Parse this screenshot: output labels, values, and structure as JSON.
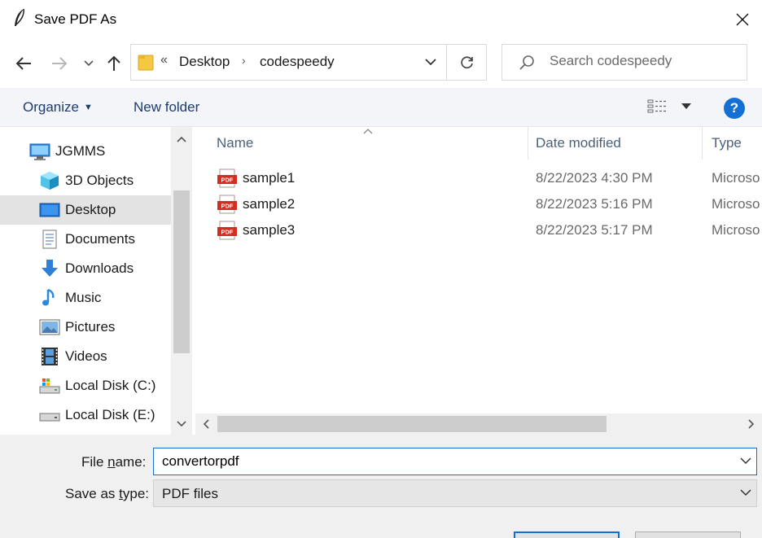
{
  "window": {
    "title": "Save PDF As"
  },
  "nav": {
    "back_icon": "arrow-left-icon",
    "forward_icon": "arrow-right-icon",
    "recent_icon": "chevron-down-icon",
    "up_icon": "arrow-up-icon"
  },
  "address": {
    "overflow": "«",
    "segments": [
      "Desktop",
      "codespeedy"
    ]
  },
  "search": {
    "placeholder": "Search codespeedy"
  },
  "toolbar": {
    "organize": "Organize",
    "new_folder": "New folder",
    "help": "?"
  },
  "tree": {
    "items": [
      {
        "label": "JGMMS",
        "icon": "computer-icon"
      },
      {
        "label": "3D Objects",
        "icon": "cube-icon"
      },
      {
        "label": "Desktop",
        "icon": "desktop-icon",
        "selected": true
      },
      {
        "label": "Documents",
        "icon": "document-icon"
      },
      {
        "label": "Downloads",
        "icon": "download-icon"
      },
      {
        "label": "Music",
        "icon": "music-note-icon"
      },
      {
        "label": "Pictures",
        "icon": "picture-icon"
      },
      {
        "label": "Videos",
        "icon": "film-icon"
      },
      {
        "label": "Local Disk (C:)",
        "icon": "drive-icon"
      },
      {
        "label": "Local Disk (E:)",
        "icon": "drive-icon"
      }
    ]
  },
  "files": {
    "columns": [
      "Name",
      "Date modified",
      "Type"
    ],
    "rows": [
      {
        "name": "sample1",
        "date": "8/22/2023 4:30 PM",
        "type": "Microso"
      },
      {
        "name": "sample2",
        "date": "8/22/2023 5:16 PM",
        "type": "Microso"
      },
      {
        "name": "sample3",
        "date": "8/22/2023 5:17 PM",
        "type": "Microso"
      }
    ]
  },
  "form": {
    "file_name_label_pre": "File ",
    "file_name_label_u": "n",
    "file_name_label_post": "ame:",
    "file_name_value": "convertorpdf",
    "type_label_pre": "Save as ",
    "type_label_u": "t",
    "type_label_post": "ype:",
    "type_value": "PDF files"
  },
  "colors": {
    "accent": "#1470d0",
    "pdf_red": "#d62b1f",
    "folder_yellow": "#f5c842"
  }
}
